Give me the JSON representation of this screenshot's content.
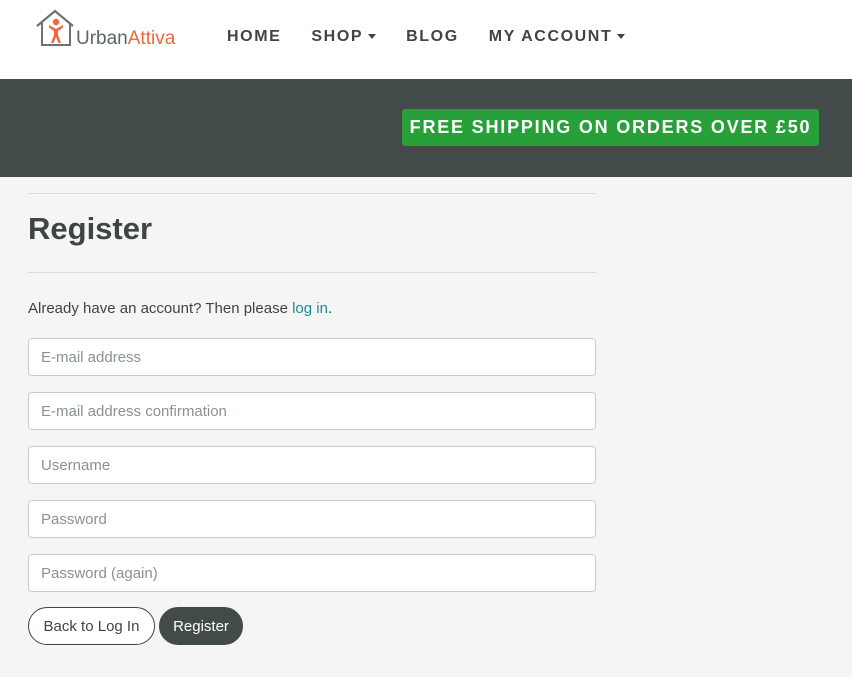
{
  "brand": {
    "name_part1": "Urban",
    "name_part2": "Attiva",
    "accent_color": "#f0673a"
  },
  "nav": {
    "home": "HOME",
    "shop": "SHOP",
    "blog": "BLOG",
    "account": "MY ACCOUNT"
  },
  "banner": {
    "shipping_text": "FREE SHIPPING ON ORDERS OVER £50",
    "background_color": "#434a4a",
    "badge_color": "#28a03a"
  },
  "register": {
    "title": "Register",
    "intro_prefix": "Already have an account? Then please ",
    "login_link": "log in",
    "intro_suffix": ".",
    "fields": {
      "email": {
        "placeholder": "E-mail address",
        "value": ""
      },
      "email_confirm": {
        "placeholder": "E-mail address confirmation",
        "value": ""
      },
      "username": {
        "placeholder": "Username",
        "value": ""
      },
      "password": {
        "placeholder": "Password",
        "value": ""
      },
      "password_again": {
        "placeholder": "Password (again)",
        "value": ""
      }
    },
    "back_button": "Back to Log In",
    "submit_button": "Register"
  }
}
